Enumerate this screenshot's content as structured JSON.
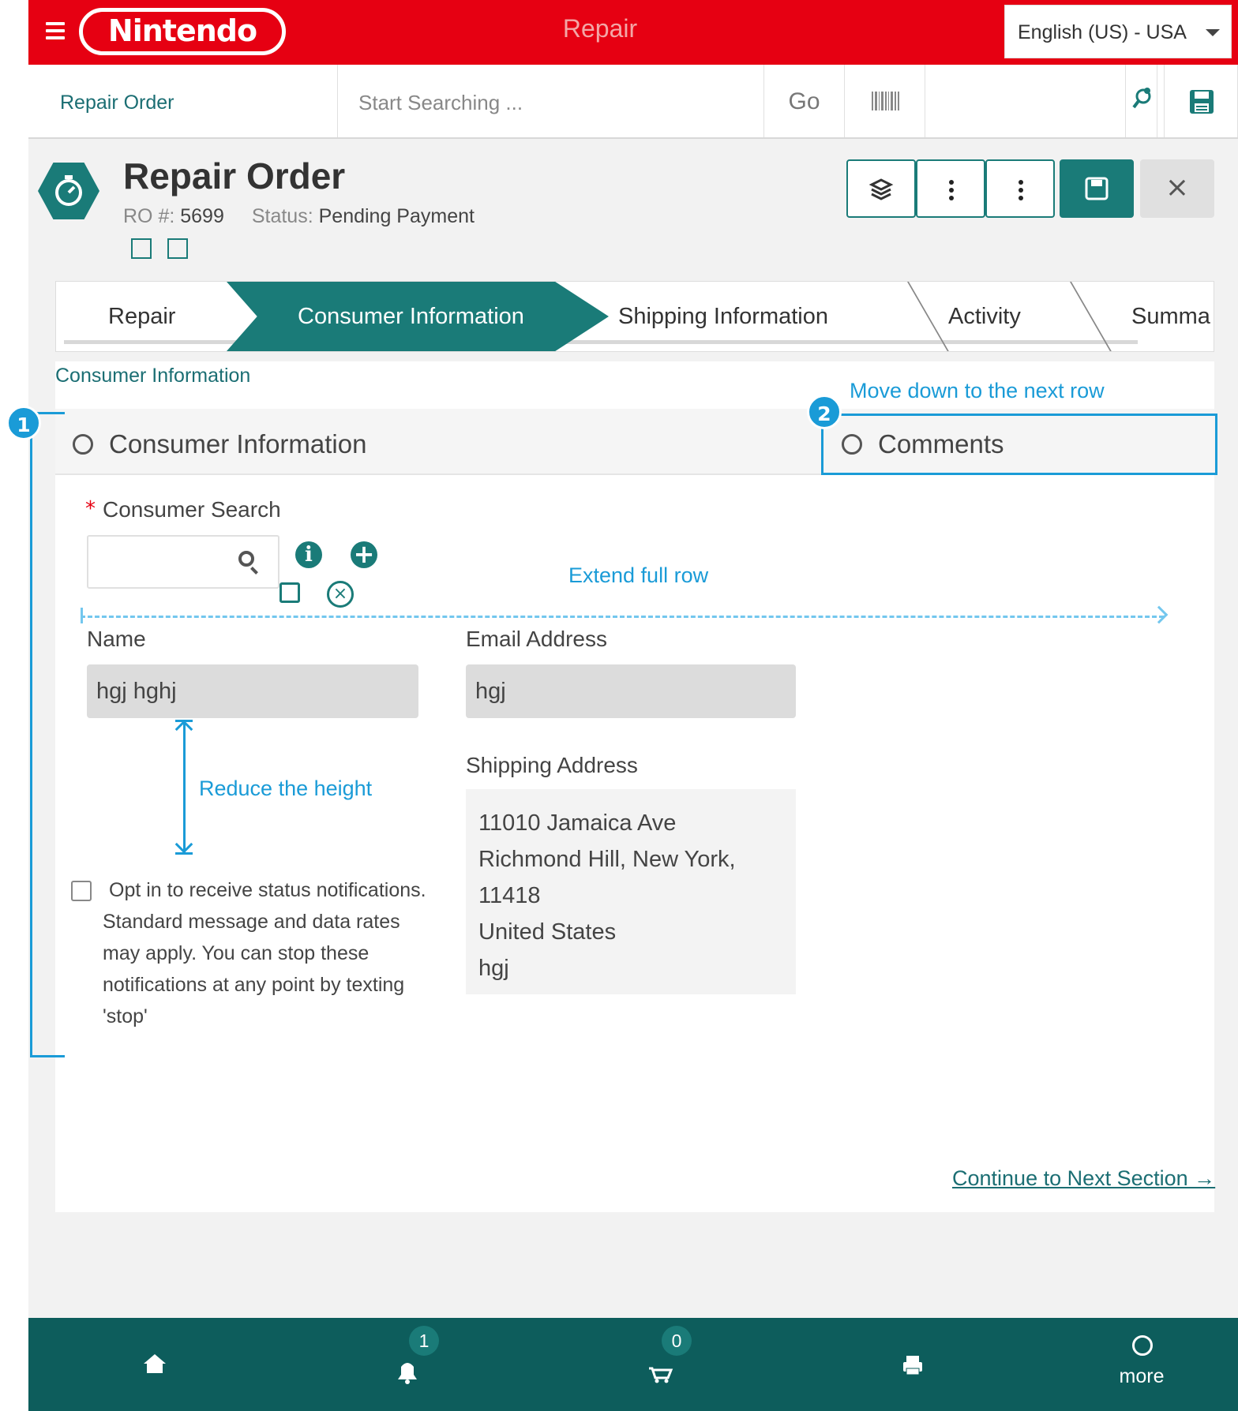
{
  "topbar": {
    "logo": "Nintendo",
    "app_title": "Repair",
    "language": "English (US) - USA"
  },
  "searchbar": {
    "breadcrumb": "Repair Order",
    "placeholder": "Start Searching ...",
    "go_label": "Go"
  },
  "header": {
    "title": "Repair Order",
    "ro_label": "RO #:",
    "ro_number": "5699",
    "status_label": "Status:",
    "status_value": "Pending Payment",
    "close_glyph": "×"
  },
  "steps": [
    {
      "label": "Repair"
    },
    {
      "label": "Consumer Information"
    },
    {
      "label": "Shipping Information"
    },
    {
      "label": "Activity"
    },
    {
      "label": "Summa"
    }
  ],
  "section": {
    "label": "Consumer Information",
    "panel_title": "Consumer Information",
    "comments_title": "Comments"
  },
  "form": {
    "required_mark": "*",
    "consumer_search_label": "Consumer Search",
    "name_label": "Name",
    "name_value": "hgj hghj",
    "email_label": "Email Address",
    "email_value": "hgj",
    "shipping_label": "Shipping Address",
    "address_lines": [
      "11010 Jamaica Ave",
      "Richmond Hill, New York,",
      "11418",
      "United States",
      "hgj"
    ],
    "optin_text": "Opt in to receive status notifications. Standard message and data rates may apply. You can stop these notifications at any point by texting 'stop'",
    "continue_label": "Continue to Next Section →"
  },
  "annotations": {
    "badge1": "1",
    "badge2": "2",
    "move_down": "Move down to the next row",
    "extend_row": "Extend full row",
    "reduce_height": "Reduce the height"
  },
  "bottomnav": {
    "notifications_count": "1",
    "cart_count": "0",
    "more_label": "more"
  },
  "colors": {
    "brand_red": "#e60012",
    "teal": "#1a7b78",
    "nav_teal": "#0d5d5c",
    "annotation_blue": "#1a9bd7"
  },
  "icons": [
    "hamburger-icon",
    "barcode-icon",
    "zoom-icon",
    "save-icon",
    "stopwatch-icon",
    "layers-icon",
    "more-vertical-icon",
    "search-icon",
    "info-icon",
    "add-icon",
    "edit-icon",
    "clear-icon",
    "collapse-icon",
    "home-icon",
    "bell-icon",
    "cart-icon",
    "printer-icon",
    "more-icon"
  ]
}
